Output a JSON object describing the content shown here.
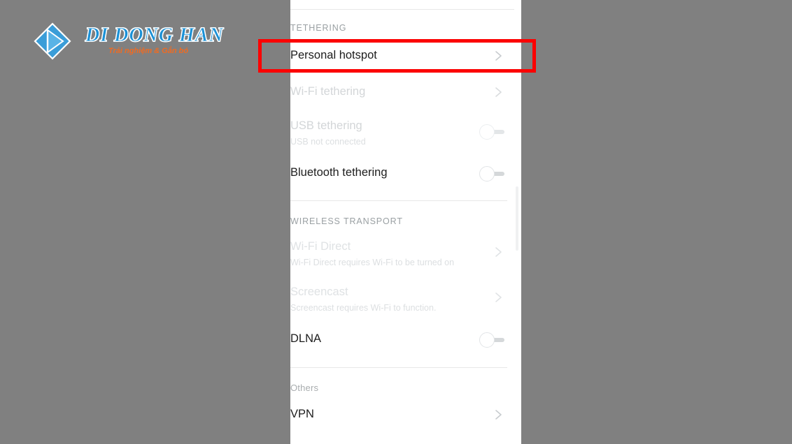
{
  "watermark": {
    "name": "di-dong-han-logo",
    "title": "DI DONG HAN",
    "tagline": "Trải nghiệm & Gắn bó",
    "brand_color": "#1b91d6",
    "tagline_color": "#ef6b22"
  },
  "background_color": "#808080",
  "panel": {
    "background_color": "#ffffff",
    "sections": [
      {
        "id": "tethering",
        "header": "TETHERING",
        "header_style": "uppercase",
        "rows": [
          {
            "id": "personal-hotspot",
            "title": "Personal hotspot",
            "subtitle": "",
            "control": "chevron",
            "state": "enabled",
            "highlighted": true
          },
          {
            "id": "wifi-tethering",
            "title": "Wi-Fi tethering",
            "subtitle": "",
            "control": "chevron",
            "state": "disabled",
            "highlighted": false
          },
          {
            "id": "usb-tethering",
            "title": "USB tethering",
            "subtitle": "USB not connected",
            "control": "toggle",
            "toggle_value": "off",
            "state": "disabled",
            "highlighted": false
          },
          {
            "id": "bluetooth-tethering",
            "title": "Bluetooth tethering",
            "subtitle": "",
            "control": "toggle",
            "toggle_value": "off",
            "state": "enabled",
            "highlighted": false
          }
        ]
      },
      {
        "id": "wireless-transport",
        "header": "WIRELESS TRANSPORT",
        "header_style": "uppercase",
        "rows": [
          {
            "id": "wifi-direct",
            "title": "Wi-Fi Direct",
            "subtitle": "Wi-Fi Direct requires Wi-Fi to be turned on",
            "control": "chevron",
            "state": "disabled",
            "highlighted": false
          },
          {
            "id": "screencast",
            "title": "Screencast",
            "subtitle": "Screencast requires Wi-Fi to function.",
            "control": "chevron",
            "state": "disabled",
            "highlighted": false
          },
          {
            "id": "dlna",
            "title": "DLNA",
            "subtitle": "",
            "control": "toggle",
            "toggle_value": "off",
            "state": "enabled",
            "highlighted": false
          }
        ]
      },
      {
        "id": "others",
        "header": "Others",
        "header_style": "mixed",
        "rows": [
          {
            "id": "vpn",
            "title": "VPN",
            "subtitle": "",
            "control": "chevron",
            "state": "enabled",
            "highlighted": false
          }
        ]
      }
    ],
    "scrollbar": {
      "visible": true
    }
  },
  "annotation": {
    "type": "rectangle-highlight",
    "color": "#fc0000",
    "targets": "personal-hotspot"
  }
}
